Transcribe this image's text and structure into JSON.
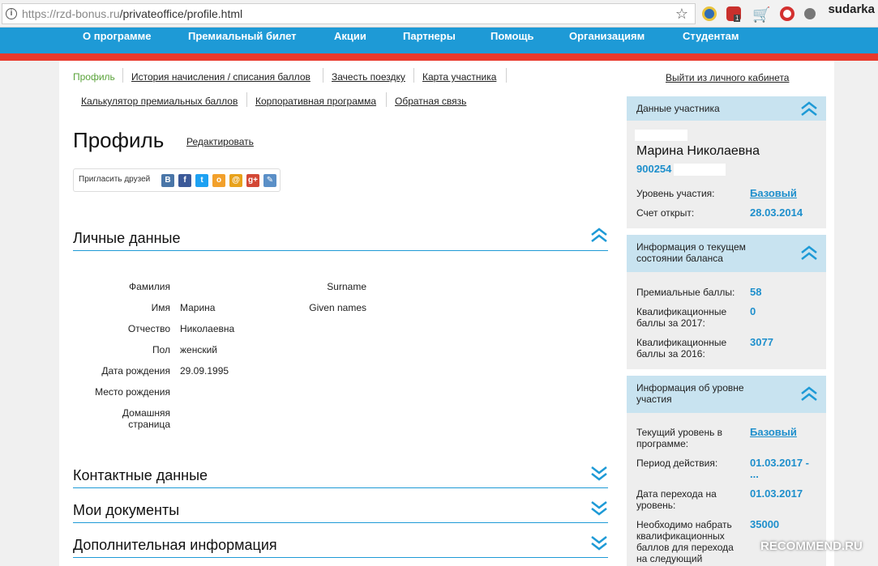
{
  "browser": {
    "url_host": "https://rzd-bonus.ru",
    "url_path": "/privateoffice/profile.html",
    "profile_name": "sudarka",
    "ext_badge": "1"
  },
  "site_nav": [
    "О программе",
    "Премиальный билет",
    "Акции",
    "Партнеры",
    "Помощь",
    "Организациям",
    "Студентам"
  ],
  "tabs_row1": [
    "Профиль",
    "История начисления / списания баллов",
    "Зачесть поездку",
    "Карта участника"
  ],
  "tabs_row2": [
    "Калькулятор премиальных баллов",
    "Корпоративная программа",
    "Обратная связь"
  ],
  "logout_link": "Выйти из личного кабинета",
  "page_title": "Профиль",
  "edit_link": "Редактировать",
  "share": {
    "label": "Пригласить друзей",
    "icons": [
      {
        "name": "vk-icon",
        "glyph": "В",
        "color": "#4a76a8"
      },
      {
        "name": "facebook-icon",
        "glyph": "f",
        "color": "#3b5998"
      },
      {
        "name": "twitter-icon",
        "glyph": "t",
        "color": "#1da1f2"
      },
      {
        "name": "odnoklassniki-icon",
        "glyph": "о",
        "color": "#f2a02b"
      },
      {
        "name": "mailru-icon",
        "glyph": "@",
        "color": "#e8a21b"
      },
      {
        "name": "googleplus-icon",
        "glyph": "g+",
        "color": "#d34836"
      },
      {
        "name": "livejournal-icon",
        "glyph": "✎",
        "color": "#5a8fc7"
      }
    ]
  },
  "sections": {
    "personal": "Личные данные",
    "contacts": "Контактные данные",
    "documents": "Мои документы",
    "additional": "Дополнительная информация"
  },
  "personal_fields": [
    {
      "label": "Фамилия",
      "value": ""
    },
    {
      "label": "Имя",
      "value": "Марина"
    },
    {
      "label": "Отчество",
      "value": "Николаевна"
    },
    {
      "label": "Пол",
      "value": "женский"
    },
    {
      "label": "Дата рождения",
      "value": "29.09.1995"
    },
    {
      "label": "Место рождения",
      "value": ""
    },
    {
      "label": "Домашняя страница",
      "value": ""
    }
  ],
  "english_fields": [
    "Surname",
    "Given names"
  ],
  "sidebar": {
    "member": {
      "title": "Данные участника",
      "name": "Марина Николаевна",
      "number": "900254",
      "level_label": "Уровень участия:",
      "level_value": "Базовый",
      "opened_label": "Счет открыт:",
      "opened_value": "28.03.2014"
    },
    "balance": {
      "title_line1": "Информация о текущем",
      "title_line2": "состоянии баланса",
      "premium_label": "Премиальные баллы:",
      "premium_value": "58",
      "q2017_line1": "Квалификационные",
      "q2017_line2": "баллы за 2017:",
      "q2017_value": "0",
      "q2016_line1": "Квалификационные",
      "q2016_line2": "баллы за 2016:",
      "q2016_value": "3077"
    },
    "level": {
      "title_line1": "Информация об уровне",
      "title_line2": "участия",
      "current_line1": "Текущий уровень в",
      "current_line2": "программе:",
      "current_value": "Базовый",
      "period_label": "Период действия:",
      "period_value_line1": "01.03.2017 -",
      "period_value_line2": "...",
      "transition_line1": "Дата перехода на",
      "transition_line2": "уровень:",
      "transition_value": "01.03.2017",
      "needed_line1": "Необходимо набрать",
      "needed_line2": "квалификационных",
      "needed_line3": "баллов для перехода",
      "needed_line4": "на следующий",
      "needed_value": "35000"
    }
  },
  "watermark": "RECOMMEND.RU",
  "colors": {
    "accent": "#1e9ad6",
    "stripe": "#e8392b",
    "active_tab": "#5aa33a",
    "value": "#1e8fcc"
  }
}
